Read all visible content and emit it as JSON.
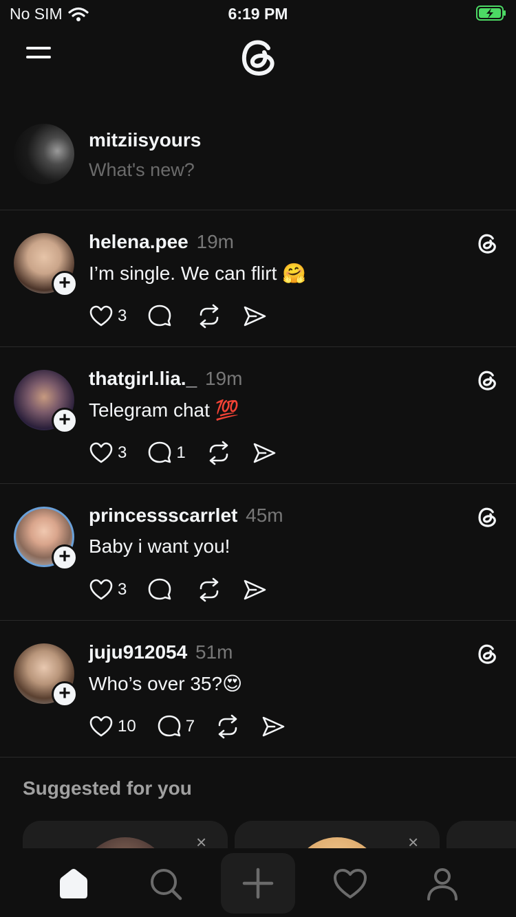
{
  "status_bar": {
    "carrier": "No SIM",
    "time": "6:19 PM"
  },
  "composer": {
    "username": "mitziisyours",
    "placeholder": "What's new?"
  },
  "posts": [
    {
      "username": "helena.pee",
      "time": "19m",
      "text": "I’m single. We can flirt 🤗",
      "likes": "3",
      "replies": "",
      "avatar_color": "#caa58a"
    },
    {
      "username": "thatgirl.lia._",
      "time": "19m",
      "text": "Telegram chat 💯",
      "likes": "3",
      "replies": "1",
      "avatar_color": "#6b5a8a"
    },
    {
      "username": "princessscarrlet",
      "time": "45m",
      "text": "Baby i want you!",
      "likes": "3",
      "replies": "",
      "avatar_color": "#d9a58c"
    },
    {
      "username": "juju912054",
      "time": "51m",
      "text": "Who’s over 35?😍",
      "likes": "10",
      "replies": "7",
      "avatar_color": "#b8957a"
    }
  ],
  "suggested": {
    "title": "Suggested for you",
    "close_glyph": "×"
  },
  "colors": {
    "background": "#101010",
    "text": "#f3f5f7",
    "secondary": "#777777",
    "battery": "#4cd964"
  },
  "icons": [
    "wifi-icon",
    "battery-icon",
    "menu-icon",
    "threads-logo",
    "heart-icon",
    "reply-icon",
    "repost-icon",
    "share-icon",
    "home-icon",
    "search-icon",
    "plus-icon",
    "activity-icon",
    "profile-icon"
  ]
}
